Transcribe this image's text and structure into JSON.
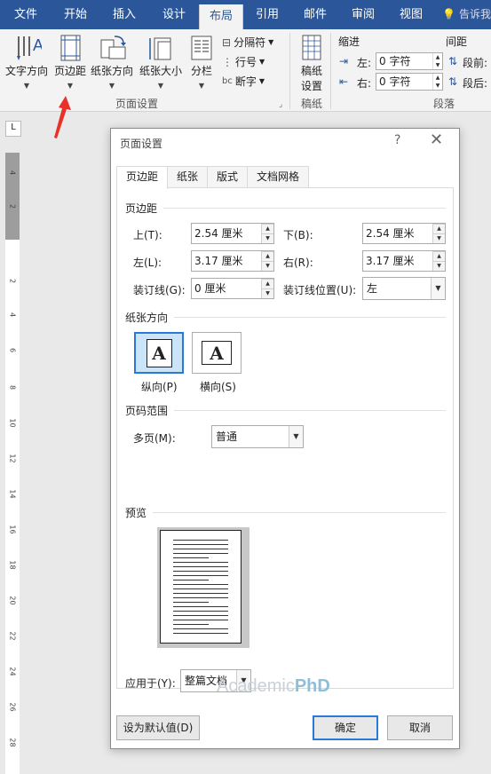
{
  "ribbon_tabs": [
    "文件",
    "开始",
    "插入",
    "设计",
    "布局",
    "引用",
    "邮件",
    "审阅",
    "视图"
  ],
  "tell_me": "告诉我",
  "ribbon": {
    "text_direction": "文字方向",
    "margins": "页边距",
    "orientation": "纸张方向",
    "size": "纸张大小",
    "columns": "分栏",
    "breaks": "分隔符",
    "line_numbers": "行号",
    "hyphenation": "断字",
    "group_page_setup": "页面设置",
    "draft_settings": "稿纸\n设置",
    "draft_settings_line1": "稿纸",
    "draft_settings_line2": "设置",
    "group_draft": "稿纸",
    "indent_label": "缩进",
    "spacing_label": "间距",
    "indent_left_label": "左:",
    "indent_right_label": "右:",
    "indent_left_value": "0 字符",
    "indent_right_value": "0 字符",
    "spacing_before_label": "段前:",
    "spacing_after_label": "段后:",
    "group_paragraph": "段落"
  },
  "ruler_numbers": [
    "4",
    "2",
    "2",
    "4",
    "6",
    "8",
    "10",
    "12",
    "14",
    "16",
    "18",
    "20",
    "22",
    "24",
    "26",
    "28"
  ],
  "dialog": {
    "title": "页面设置",
    "help": "?",
    "close": "✕",
    "tabs": [
      "页边距",
      "纸张",
      "版式",
      "文档网格"
    ],
    "margins_section": "页边距",
    "top_label": "上(T):",
    "top_value": "2.54 厘米",
    "bottom_label": "下(B):",
    "bottom_value": "2.54 厘米",
    "left_label": "左(L):",
    "left_value": "3.17 厘米",
    "right_label": "右(R):",
    "right_value": "3.17 厘米",
    "gutter_label": "装订线(G):",
    "gutter_value": "0 厘米",
    "gutter_pos_label": "装订线位置(U):",
    "gutter_pos_value": "左",
    "orientation_section": "纸张方向",
    "portrait_label": "纵向(P)",
    "landscape_label": "横向(S)",
    "orientation_glyph": "A",
    "pages_section": "页码范围",
    "multiple_pages_label": "多页(M):",
    "multiple_pages_value": "普通",
    "preview_section": "预览",
    "apply_to_label": "应用于(Y):",
    "apply_to_value": "整篇文档",
    "set_default": "设为默认值(D)",
    "ok": "确定",
    "cancel": "取消"
  },
  "watermark": {
    "part1": "Academic",
    "part2": "PhD"
  },
  "colors": {
    "ribbon_blue": "#2b579a",
    "accent": "#2b79d6",
    "arrow_red": "#e8312a"
  }
}
